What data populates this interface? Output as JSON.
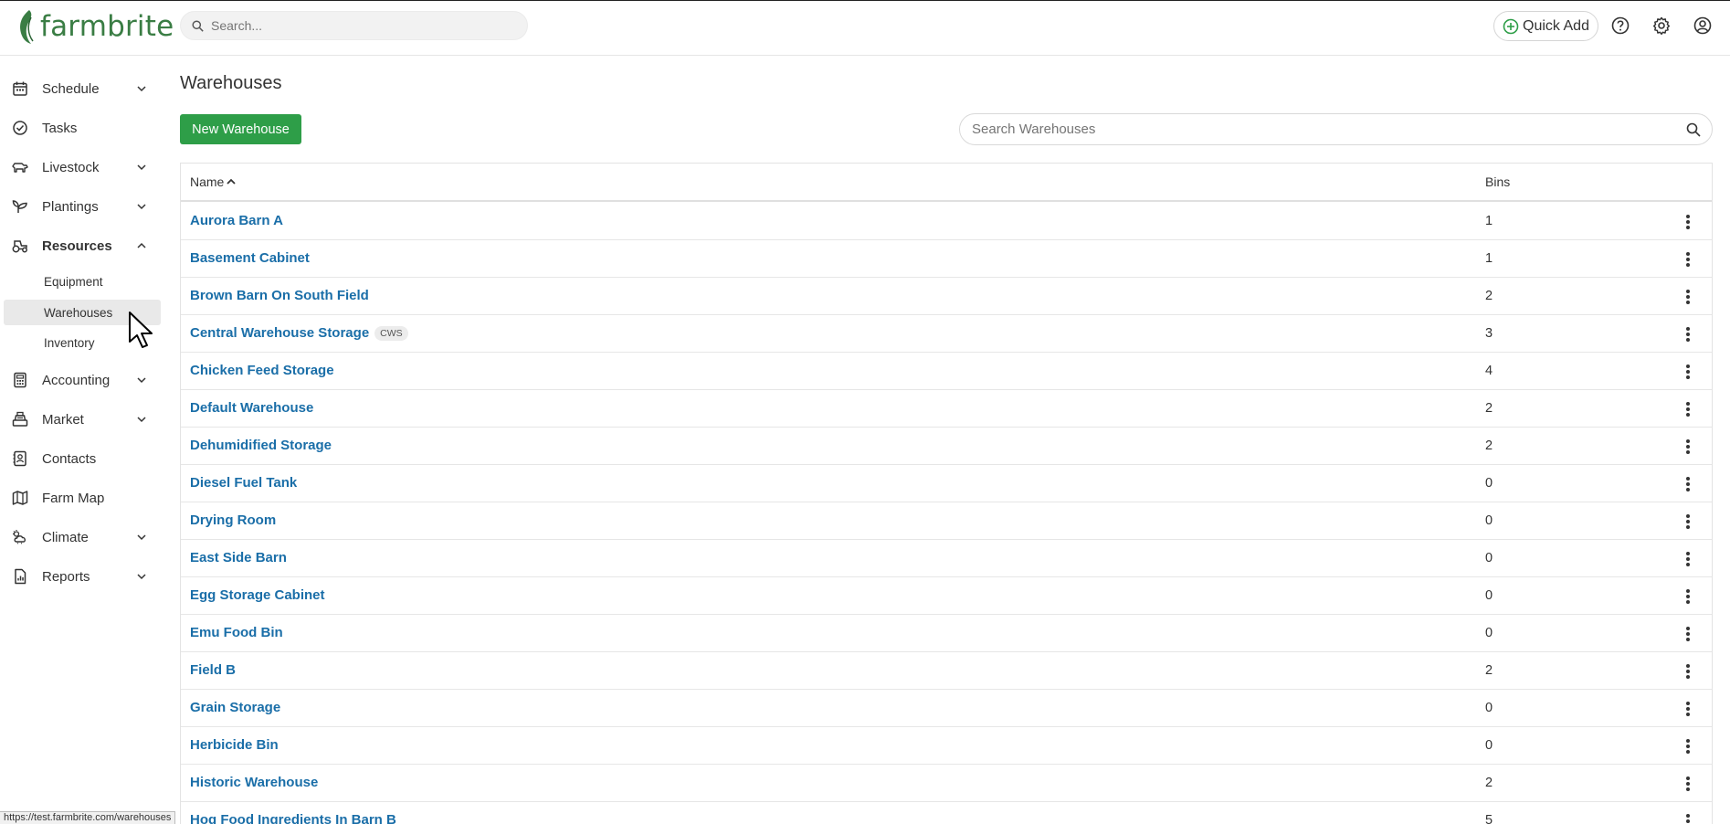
{
  "header": {
    "logo_text": "farmbrite",
    "search_placeholder": "Search...",
    "quick_add_label": "Quick Add"
  },
  "colors": {
    "brand_green": "#3a7d44",
    "button_green": "#2e9e48",
    "link_blue": "#1a6ea8"
  },
  "sidebar": {
    "items": [
      {
        "label": "Schedule",
        "icon": "calendar-icon",
        "expandable": true
      },
      {
        "label": "Tasks",
        "icon": "check-circle-icon",
        "expandable": false
      },
      {
        "label": "Livestock",
        "icon": "livestock-icon",
        "expandable": true
      },
      {
        "label": "Plantings",
        "icon": "sprout-icon",
        "expandable": true
      },
      {
        "label": "Resources",
        "icon": "tractor-icon",
        "expandable": true,
        "expanded": true
      },
      {
        "label": "Accounting",
        "icon": "calculator-icon",
        "expandable": true
      },
      {
        "label": "Market",
        "icon": "cash-register-icon",
        "expandable": true
      },
      {
        "label": "Contacts",
        "icon": "address-book-icon",
        "expandable": false
      },
      {
        "label": "Farm Map",
        "icon": "map-icon",
        "expandable": false
      },
      {
        "label": "Climate",
        "icon": "cloud-sun-icon",
        "expandable": true
      },
      {
        "label": "Reports",
        "icon": "report-icon",
        "expandable": true
      }
    ],
    "resources_sub": [
      {
        "label": "Equipment"
      },
      {
        "label": "Warehouses",
        "active": true
      },
      {
        "label": "Inventory"
      }
    ]
  },
  "main": {
    "title": "Warehouses",
    "new_button_label": "New Warehouse",
    "search_placeholder": "Search Warehouses",
    "columns": {
      "name": "Name",
      "bins": "Bins"
    },
    "rows": [
      {
        "name": "Aurora Barn A",
        "bins": "1"
      },
      {
        "name": "Basement Cabinet",
        "bins": "1"
      },
      {
        "name": "Brown Barn On South Field",
        "bins": "2"
      },
      {
        "name": "Central Warehouse Storage",
        "tag": "CWS",
        "bins": "3"
      },
      {
        "name": "Chicken Feed Storage",
        "bins": "4"
      },
      {
        "name": "Default Warehouse",
        "bins": "2"
      },
      {
        "name": "Dehumidified Storage",
        "bins": "2"
      },
      {
        "name": "Diesel Fuel Tank",
        "bins": "0"
      },
      {
        "name": "Drying Room",
        "bins": "0"
      },
      {
        "name": "East Side Barn",
        "bins": "0"
      },
      {
        "name": "Egg Storage Cabinet",
        "bins": "0"
      },
      {
        "name": "Emu Food Bin",
        "bins": "0"
      },
      {
        "name": "Field B",
        "bins": "2"
      },
      {
        "name": "Grain Storage",
        "bins": "0"
      },
      {
        "name": "Herbicide Bin",
        "bins": "0"
      },
      {
        "name": "Historic Warehouse",
        "bins": "2"
      },
      {
        "name": "Hog Food Ingredients In Barn B",
        "bins": "5"
      }
    ]
  },
  "status_bar": {
    "url": "https://test.farmbrite.com/warehouses"
  }
}
